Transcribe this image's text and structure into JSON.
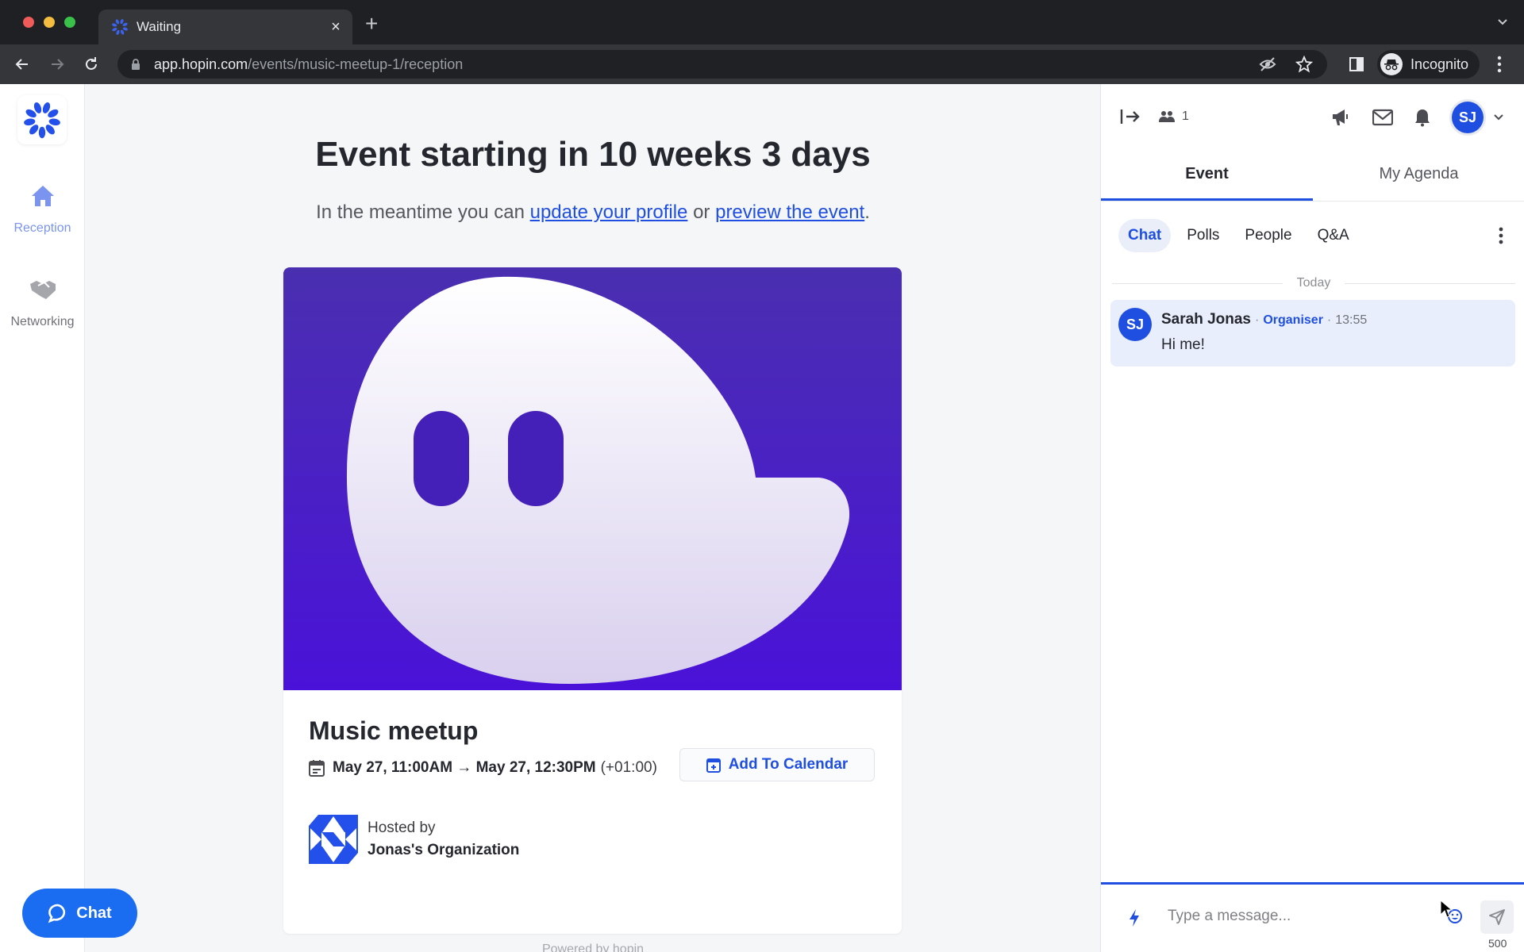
{
  "browser": {
    "tab_title": "Waiting",
    "url_host": "app.hopin.com",
    "url_path": "/events/music-meetup-1/reception",
    "profile_label": "Incognito"
  },
  "leftnav": {
    "items": [
      {
        "label": "Reception",
        "icon": "home-icon",
        "active": true
      },
      {
        "label": "Networking",
        "icon": "handshake-icon",
        "active": false
      }
    ],
    "chat_button": "Chat"
  },
  "main": {
    "headline": "Event starting in 10 weeks 3 days",
    "sub_prefix": "In the meantime you can ",
    "link_profile": "update your profile",
    "sub_mid": " or ",
    "link_preview": "preview the event",
    "sub_suffix": ".",
    "event": {
      "title": "Music meetup",
      "date_range": "May 27, 11:00AM → May 27, 12:30PM",
      "timezone": "(+01:00)",
      "add_calendar": "Add To Calendar",
      "hosted_by_label": "Hosted by",
      "host_name": "Jonas's Organization"
    },
    "footer": "Powered by hopin"
  },
  "panel": {
    "attendee_count": "1",
    "avatar_initials": "SJ",
    "tabs": [
      {
        "label": "Event",
        "active": true
      },
      {
        "label": "My Agenda",
        "active": false
      }
    ],
    "subtabs": [
      {
        "label": "Chat",
        "active": true
      },
      {
        "label": "Polls",
        "active": false
      },
      {
        "label": "People",
        "active": false
      },
      {
        "label": "Q&A",
        "active": false
      }
    ],
    "day_divider": "Today",
    "messages": [
      {
        "initials": "SJ",
        "author": "Sarah Jonas",
        "role": "Organiser",
        "time": "13:55",
        "text": "Hi me!"
      }
    ],
    "composer": {
      "placeholder": "Type a message...",
      "char_limit": "500"
    }
  },
  "colors": {
    "accent": "#1f4fe0",
    "chat_fab": "#1a6cf0",
    "event_image_top": "#4a2fb0",
    "event_image_bottom": "#4a12d8"
  }
}
